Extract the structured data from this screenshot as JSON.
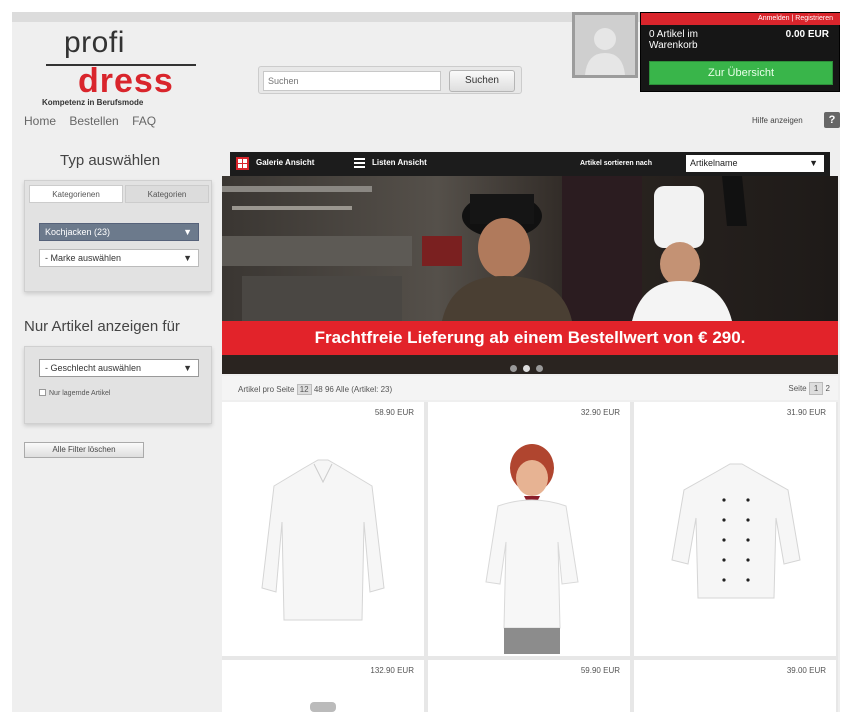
{
  "header": {
    "logo_top": "profi",
    "logo_bottom": "dress",
    "logo_tagline": "Kompetenz in Berufsmode",
    "search_placeholder": "Suchen",
    "search_button": "Suchen"
  },
  "cart": {
    "top_links": "Anmelden | Registrieren",
    "count_text": "0 Artikel im Warenkorb",
    "sum": "0.00 EUR",
    "checkout_button": "Zur Übersicht",
    "accent_color": "#39b54a"
  },
  "nav": {
    "items": [
      "Home",
      "Bestellen",
      "FAQ"
    ],
    "help_label": "Hilfe anzeigen",
    "help_icon": "?"
  },
  "sidebar": {
    "type_title": "Typ auswählen",
    "tab_a": "Kategorienen",
    "tab_b": "Kategorien",
    "category_select": "Kochjacken (23)",
    "brand_select": "- Marke auswählen",
    "filter_title": "Nur Artikel anzeigen für",
    "gender_select": "- Geschlecht auswählen",
    "checkbox_label": "Nur lagernde Artikel",
    "clear_button": "Alle Filter löschen"
  },
  "toolbar": {
    "gallery_label": "Galerie Ansicht",
    "list_label": "Listen Ansicht",
    "sort_label": "Artikel sortieren nach",
    "sort_value": "Artikelname"
  },
  "hero": {
    "banner_text": "Frachtfreie Lieferung ab einem Bestellwert von € 290.",
    "banner_color": "#e2232a"
  },
  "pagination": {
    "per_page_label": "Artikel pro Seite",
    "per_page_options": [
      "12",
      "48",
      "96",
      "Alle"
    ],
    "total": "(Artikel: 23)",
    "page_label": "Seite",
    "pages": [
      "1",
      "2"
    ]
  },
  "products": {
    "prices": [
      "58.90 EUR",
      "32.90 EUR",
      "31.90 EUR",
      "132.90 EUR",
      "59.90 EUR",
      "39.00 EUR"
    ]
  }
}
